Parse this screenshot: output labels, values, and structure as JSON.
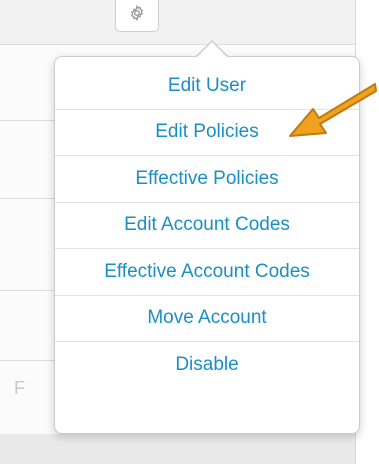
{
  "toolbar": {
    "gear_icon": "gear-icon"
  },
  "menu": {
    "items": [
      {
        "label": "Edit User"
      },
      {
        "label": "Edit Policies"
      },
      {
        "label": "Effective Policies"
      },
      {
        "label": "Edit Account Codes"
      },
      {
        "label": "Effective Account Codes"
      },
      {
        "label": "Move Account"
      },
      {
        "label": "Disable"
      }
    ]
  },
  "colors": {
    "menu_text": "#1a8fc4",
    "annotation_arrow": "#f0a21e"
  },
  "background": {
    "partial_text": "F"
  }
}
